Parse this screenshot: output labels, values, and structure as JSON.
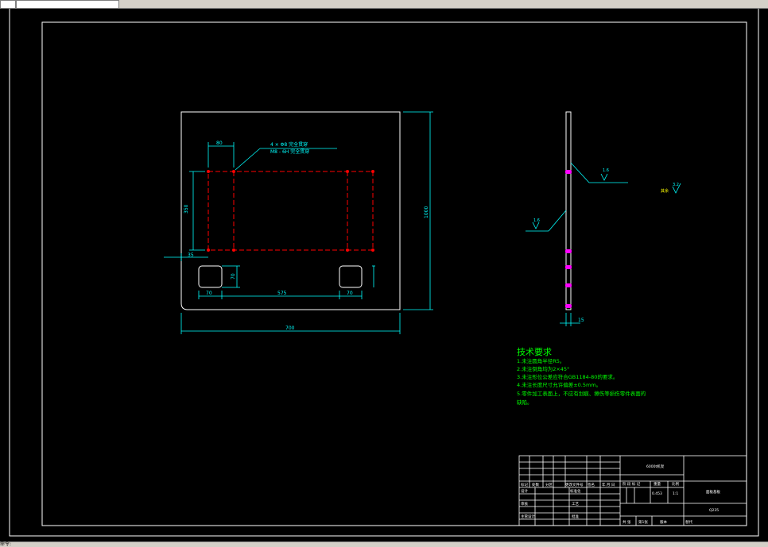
{
  "colors": {
    "background": "#000000",
    "frame": "#ffffff",
    "dimension": "#00ffff",
    "hidden_line": "#ff0000",
    "text": "#00ff00",
    "hole_mark": "#ff00ff",
    "title_block": "#ffffff",
    "topbar": "#d4d0c8"
  },
  "drawing": {
    "dims": {
      "top_width": "80",
      "height_left": "350",
      "left_offset": "35",
      "slot_height": "70",
      "slot_left": "70",
      "slot_mid": "575",
      "slot_right": "70",
      "overall_width": "700",
      "overall_height": "1000",
      "thickness": "15"
    },
    "callout": {
      "line1": "4 × Φ8  完全贯穿",
      "line2": "M8 - 6H  完全贯穿"
    },
    "roughness": {
      "side_upper": "1.6",
      "side_lower": "1.6",
      "other": "3.2",
      "other_prefix": "其余"
    }
  },
  "tech_requirements": {
    "title": "技术要求",
    "lines": [
      "1.未注圆角半径R5。",
      "2.未注倒角均为2×45°",
      "3.未注形位公差应符合GB1184-80的要求。",
      "4.未注长度尺寸允许偏差±0.5mm。",
      "5.零件加工表面上，不应有划痕、擦伤等损伤零件表面的",
      "  缺陷。"
    ]
  },
  "title_block": {
    "project": "6000t机架",
    "part_name": "面板基板",
    "material": "Q235",
    "labels": {
      "mark": "标记",
      "count": "处数",
      "zone": "分区",
      "change_doc": "更改文件号",
      "signature": "签名",
      "date": "年 月 日",
      "design": "设计",
      "standardize": "标准化",
      "check": "审核",
      "process": "工艺",
      "approve": "批准",
      "chief_designer": "主管设计",
      "stage_mark": "阶 段 标 记",
      "weight": "重量",
      "scale": "比例",
      "sheets_total": "共 张",
      "sheet_n": "第1张",
      "version": "版本",
      "replace": "替代"
    },
    "weight_value": "0.453",
    "scale_value": "1:1"
  },
  "statusbar": {
    "text": "命令:"
  }
}
